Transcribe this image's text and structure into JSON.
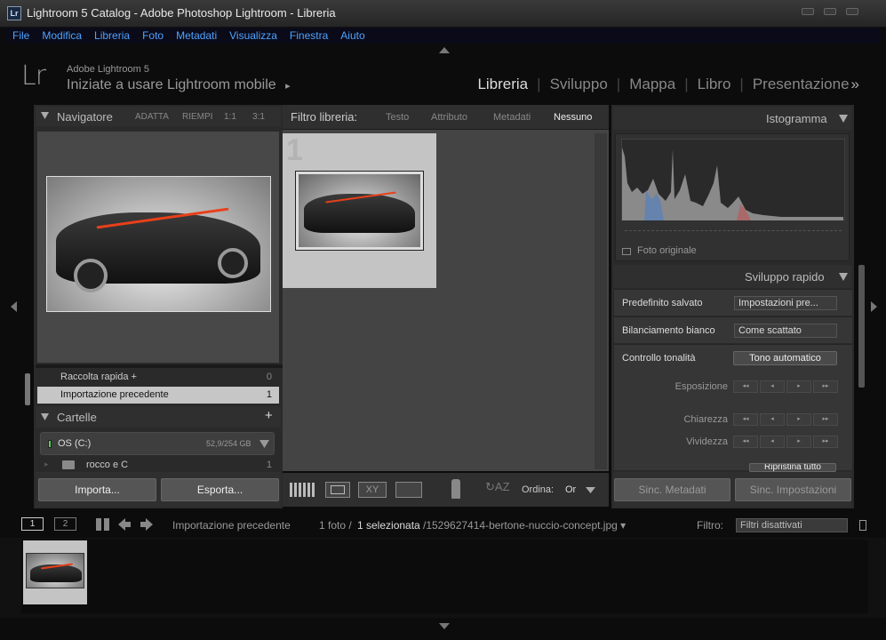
{
  "window": {
    "title": "Lightroom 5 Catalog - Adobe Photoshop Lightroom - Libreria",
    "app_icon": "Lr"
  },
  "menu": [
    "File",
    "Modifica",
    "Libreria",
    "Foto",
    "Metadati",
    "Visualizza",
    "Finestra",
    "Aiuto"
  ],
  "identity": {
    "logo": "Lr",
    "product": "Adobe Lightroom 5",
    "headline": "Iniziate a usare Lightroom mobile",
    "arrow": "▸"
  },
  "modules": [
    "Libreria",
    "Sviluppo",
    "Mappa",
    "Libro",
    "Presentazione"
  ],
  "modules_more": "»",
  "navigator": {
    "title": "Navigatore",
    "zoom": [
      "ADATTA",
      "RIEMPI",
      "1:1",
      "3:1"
    ]
  },
  "collections": [
    {
      "name": "Raccolta rapida +",
      "count": "0"
    },
    {
      "name": "Importazione precedente",
      "count": "1"
    }
  ],
  "folders": {
    "title": "Cartelle",
    "volume": "OS (C:)",
    "volume_size": "52,9/254 GB",
    "folder": "rocco e C",
    "folder_count": "1"
  },
  "left_buttons": {
    "import": "Importa...",
    "export": "Esporta..."
  },
  "filter": {
    "label": "Filtro libreria:",
    "options": [
      "Testo",
      "Attributo",
      "Metadati",
      "Nessuno"
    ],
    "active": "Nessuno"
  },
  "grid": {
    "cell_index": "1"
  },
  "toolbar": {
    "sort_label": "Ordina:",
    "sort_value": "Or"
  },
  "histogram": {
    "title": "Istogramma",
    "original_label": "Foto originale"
  },
  "quick_develop": {
    "title": "Sviluppo rapido",
    "saved_preset_label": "Predefinito salvato",
    "saved_preset_value": "Impostazioni pre...",
    "wb_label": "Bilanciamento bianco",
    "wb_value": "Come scattato",
    "tone_label": "Controllo tonalità",
    "auto_tone": "Tono automatico",
    "exposure": "Esposizione",
    "clarity": "Chiarezza",
    "vibrance": "Vividezza",
    "reset_all": "Ripristina tutto",
    "steps": [
      "◂◂",
      "◂",
      "▸",
      "▸▸"
    ]
  },
  "right_buttons": {
    "sync_meta": "Sinc. Metadati",
    "sync_settings": "Sinc. Impostazioni"
  },
  "filmstrip_bar": {
    "screen1": "1",
    "screen2": "2",
    "source": "Importazione precedente",
    "count": "1 foto /",
    "selected": "1 selezionata",
    "filename": "/1529627414-bertone-nuccio-concept.jpg ▾",
    "filter_label": "Filtro:",
    "filter_value": "Filtri disattivati"
  },
  "colors": {
    "accent_menu": "#4fa3ff",
    "car_stripe": "#e8401a",
    "background": "#0c0c0c"
  }
}
